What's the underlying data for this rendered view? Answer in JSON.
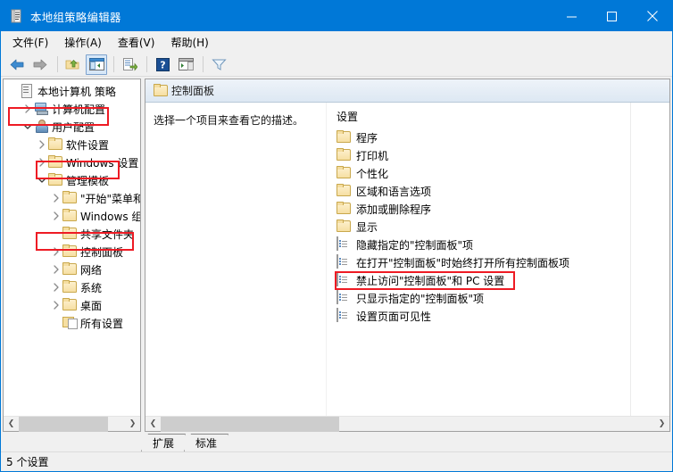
{
  "window": {
    "title": "本地组策略编辑器",
    "icon": "policy-scroll-icon",
    "minimize": "—",
    "maximize": "□",
    "close": "✕"
  },
  "menubar": {
    "items": [
      {
        "label": "文件(F)",
        "name": "menu-file"
      },
      {
        "label": "操作(A)",
        "name": "menu-action"
      },
      {
        "label": "查看(V)",
        "name": "menu-view"
      },
      {
        "label": "帮助(H)",
        "name": "menu-help"
      }
    ]
  },
  "toolbar": {
    "buttons": [
      {
        "name": "back-icon",
        "title": "后退"
      },
      {
        "name": "forward-icon",
        "title": "前进"
      },
      {
        "name": "up-one-level-icon",
        "title": "上移一级"
      },
      {
        "name": "show-hide-tree-icon",
        "title": "显示/隐藏控制台树"
      },
      {
        "name": "export-list-icon",
        "title": "导出列表"
      },
      {
        "name": "help-icon",
        "title": "帮助"
      },
      {
        "name": "show-action-pane-icon",
        "title": "显示/隐藏操作窗格"
      },
      {
        "name": "filter-icon",
        "title": "筛选器"
      }
    ]
  },
  "tree": {
    "nodes": [
      {
        "label": "本地计算机 策略",
        "icon": "policy-scroll-icon",
        "indent": 0,
        "twist": "none",
        "highlight": false
      },
      {
        "label": "计算机配置",
        "icon": "computer-icon",
        "indent": 1,
        "twist": "collapsed",
        "highlight": false
      },
      {
        "label": "用户配置",
        "icon": "user-icon",
        "indent": 1,
        "twist": "expanded",
        "highlight": true
      },
      {
        "label": "软件设置",
        "icon": "folder-icon",
        "indent": 2,
        "twist": "collapsed",
        "highlight": false
      },
      {
        "label": "Windows 设置",
        "icon": "folder-icon",
        "indent": 2,
        "twist": "collapsed",
        "highlight": false
      },
      {
        "label": "管理模板",
        "icon": "folder-icon",
        "indent": 2,
        "twist": "expanded",
        "highlight": true
      },
      {
        "label": "\"开始\"菜单和",
        "icon": "folder-icon",
        "indent": 3,
        "twist": "collapsed",
        "highlight": false
      },
      {
        "label": "Windows 组",
        "icon": "folder-icon",
        "indent": 3,
        "twist": "collapsed",
        "highlight": false
      },
      {
        "label": "共享文件夹",
        "icon": "folder-icon",
        "indent": 3,
        "twist": "none",
        "highlight": false
      },
      {
        "label": "控制面板",
        "icon": "folder-icon",
        "indent": 3,
        "twist": "collapsed",
        "highlight": true
      },
      {
        "label": "网络",
        "icon": "folder-icon",
        "indent": 3,
        "twist": "collapsed",
        "highlight": false
      },
      {
        "label": "系统",
        "icon": "folder-icon",
        "indent": 3,
        "twist": "collapsed",
        "highlight": false
      },
      {
        "label": "桌面",
        "icon": "folder-icon",
        "indent": 3,
        "twist": "collapsed",
        "highlight": false
      },
      {
        "label": "所有设置",
        "icon": "all-settings-icon",
        "indent": 3,
        "twist": "none",
        "highlight": false
      }
    ],
    "hscroll": {
      "left_arrow": "❮",
      "right_arrow": "❯"
    }
  },
  "right_pane": {
    "header_title": "控制面板",
    "header_icon": "folder-icon",
    "description": "选择一个项目来查看它的描述。",
    "column_title": "设置",
    "items": [
      {
        "label": "程序",
        "icon": "folder-icon",
        "highlight": false
      },
      {
        "label": "打印机",
        "icon": "folder-icon",
        "highlight": false
      },
      {
        "label": "个性化",
        "icon": "folder-icon",
        "highlight": false
      },
      {
        "label": "区域和语言选项",
        "icon": "folder-icon",
        "highlight": false
      },
      {
        "label": "添加或删除程序",
        "icon": "folder-icon",
        "highlight": false
      },
      {
        "label": "显示",
        "icon": "folder-icon",
        "highlight": false
      },
      {
        "label": "隐藏指定的\"控制面板\"项",
        "icon": "policy-setting-icon",
        "highlight": false
      },
      {
        "label": "在打开\"控制面板\"时始终打开所有控制面板项",
        "icon": "policy-setting-icon",
        "highlight": false
      },
      {
        "label": "禁止访问\"控制面板\"和 PC 设置",
        "icon": "policy-setting-icon",
        "highlight": true
      },
      {
        "label": "只显示指定的\"控制面板\"项",
        "icon": "policy-setting-icon",
        "highlight": false
      },
      {
        "label": "设置页面可见性",
        "icon": "policy-setting-icon",
        "highlight": false
      }
    ],
    "hscroll": {
      "left_arrow": "❮",
      "right_arrow": "❯"
    }
  },
  "tabs": [
    {
      "label": "扩展",
      "name": "tab-extended",
      "active": false
    },
    {
      "label": "标准",
      "name": "tab-standard",
      "active": true
    }
  ],
  "statusbar": {
    "text": "5 个设置"
  },
  "colors": {
    "titlebar": "#0078d7",
    "annotation": "#ee1b24",
    "header_gradient_top": "#eef3f9",
    "header_gradient_bottom": "#dde8f3"
  }
}
